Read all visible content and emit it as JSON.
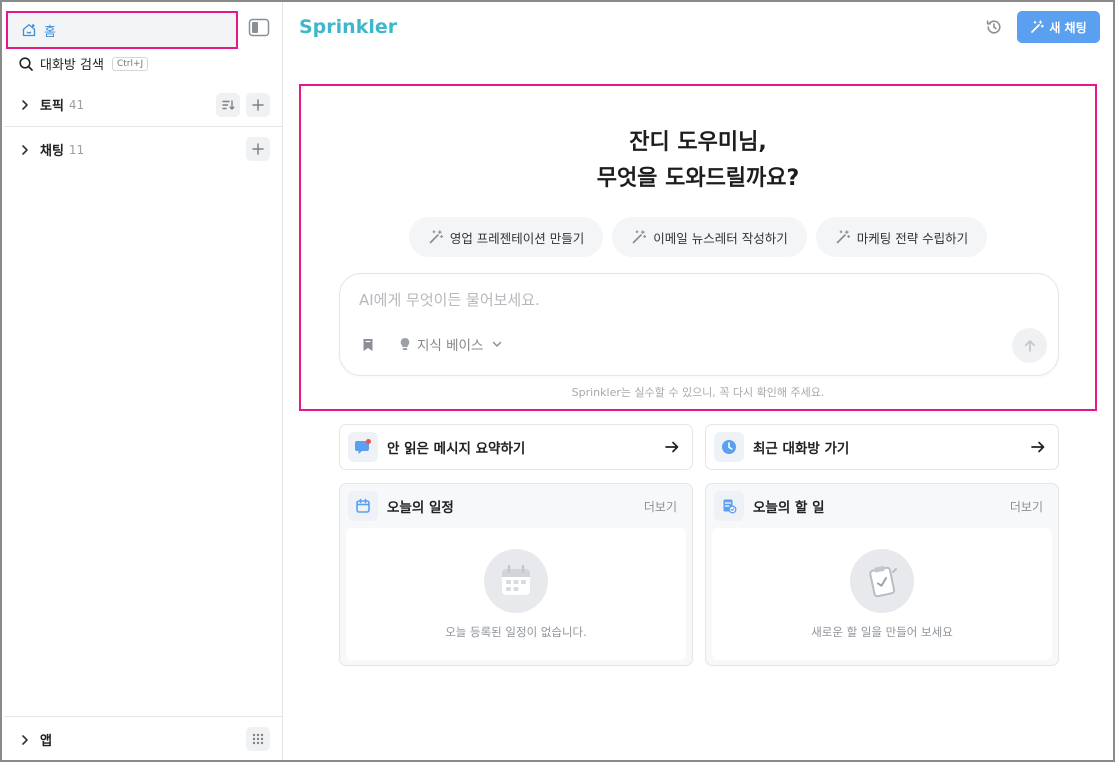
{
  "colors": {
    "accent": "#5b9ff0",
    "brand": "#3fb6c9",
    "highlight_border": "#e6168b",
    "sidebar_active_text": "#3a8fd8"
  },
  "sidebar": {
    "home_label": "홈",
    "search_label": "대화방 검색",
    "search_shortcut": "Ctrl+J",
    "topics": {
      "label": "토픽",
      "count": "41"
    },
    "chats": {
      "label": "채팅",
      "count": "11"
    },
    "apps_label": "앱"
  },
  "header": {
    "brand": "Sprinkler",
    "new_chat_label": "새 채팅"
  },
  "hero": {
    "greeting_line1": "잔디 도우미님,",
    "greeting_line2": "무엇을 도와드릴까요?",
    "chips": [
      {
        "label": "영업 프레젠테이션 만들기"
      },
      {
        "label": "이메일 뉴스레터 작성하기"
      },
      {
        "label": "마케팅 전략 수립하기"
      }
    ],
    "input_placeholder": "AI에게 무엇이든 물어보세요.",
    "knowledge_base_label": "지식 베이스",
    "disclaimer": "Sprinkler는 실수할 수 있으니, 꼭 다시 확인해 주세요."
  },
  "actions": {
    "unread_summary": "안 읽은 메시지 요약하기",
    "recent_rooms": "최근 대화방 가기"
  },
  "panels": {
    "schedule": {
      "title": "오늘의 일정",
      "more": "더보기",
      "empty": "오늘 등록된 일정이 없습니다."
    },
    "todo": {
      "title": "오늘의 할 일",
      "more": "더보기",
      "empty": "새로운 할 일을 만들어 보세요"
    }
  }
}
